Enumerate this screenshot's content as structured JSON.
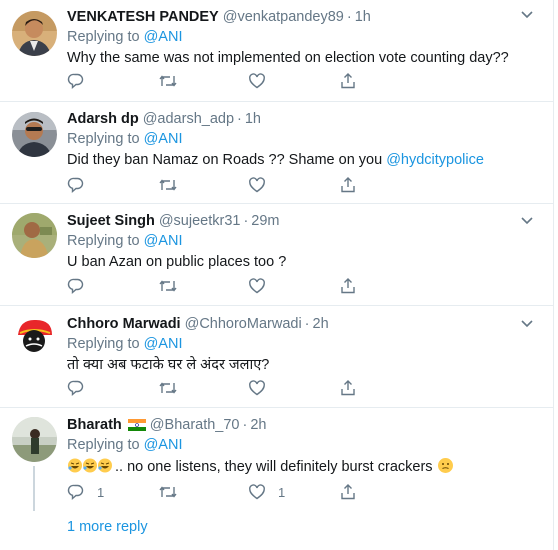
{
  "tweets": [
    {
      "name": "VENKATESH PANDEY",
      "handle": "@venkatpandey89",
      "dot": "·",
      "time": "1h",
      "replying_prefix": "Replying to",
      "replying_handle": "@ANI",
      "text": "Why the same was not implemented on election vote counting day??",
      "reply_count": "",
      "like_count": ""
    },
    {
      "name": "Adarsh dp",
      "handle": "@adarsh_adp",
      "dot": "·",
      "time": "1h",
      "replying_prefix": "Replying to",
      "replying_handle": "@ANI",
      "text": "Did they ban Namaz on Roads ?? Shame on you",
      "text_mention": "@hydcitypolice",
      "reply_count": "",
      "like_count": ""
    },
    {
      "name": "Sujeet Singh",
      "handle": "@sujeetkr31",
      "dot": "·",
      "time": "29m",
      "replying_prefix": "Replying to",
      "replying_handle": "@ANI",
      "text": "U ban Azan on public places too ?",
      "reply_count": "",
      "like_count": ""
    },
    {
      "name": "Chhoro Marwadi",
      "handle": "@ChhoroMarwadi",
      "dot": "·",
      "time": "2h",
      "replying_prefix": "Replying to",
      "replying_handle": "@ANI",
      "text": "तो क्या अब फटाके घर ले अंदर जलाए?",
      "reply_count": "",
      "like_count": ""
    },
    {
      "name": "Bharath",
      "handle": "@Bharath_70",
      "dot": "·",
      "time": "2h",
      "replying_prefix": "Replying to",
      "replying_handle": "@ANI",
      "text": ".. no one listens, they will definitely burst crackers",
      "reply_count": "1",
      "like_count": "1"
    }
  ],
  "thread": {
    "more_reply_label": "1 more reply"
  },
  "icons": {
    "reply": "reply-icon",
    "retweet": "retweet-icon",
    "like": "heart-icon",
    "share": "share-icon",
    "caret": "chevron-down-icon",
    "flag": "india-flag-icon",
    "emoji_laugh": "rolling-laughing-emoji",
    "emoji_face": "face-emoji"
  },
  "colors": {
    "link": "#1b95e0",
    "muted": "#657786",
    "divider": "#e6ecf0"
  }
}
